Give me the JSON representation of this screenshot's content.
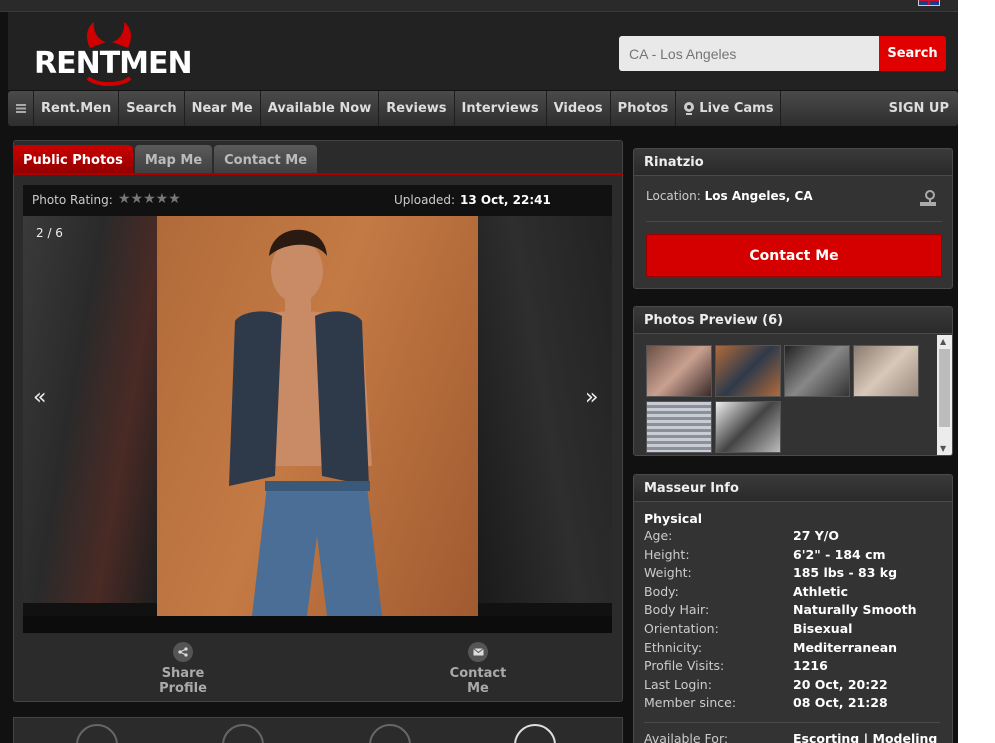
{
  "brand": {
    "logo_text": "RENTMEN"
  },
  "search": {
    "placeholder": "CA - Los Angeles",
    "button": "Search"
  },
  "nav": {
    "menu_icon": "menu-icon",
    "items": [
      "Rent.Men",
      "Search",
      "Near Me",
      "Available Now",
      "Reviews",
      "Interviews",
      "Videos",
      "Photos",
      "Live Cams"
    ],
    "signup": "SIGN UP"
  },
  "tabs": [
    "Public Photos",
    "Map Me",
    "Contact Me"
  ],
  "photo": {
    "rating_label": "Photo Rating:",
    "stars": "★★★★★",
    "uploaded_label": "Uploaded:",
    "uploaded_value": "13 Oct, 22:41",
    "counter": "2 / 6",
    "prev": "«",
    "next": "»"
  },
  "actions": {
    "share": "Share Profile",
    "contact": "Contact Me"
  },
  "profile": {
    "name": "Rinatzio",
    "location_label": "Location:",
    "location_value": "Los Angeles, CA",
    "contact_button": "Contact Me"
  },
  "preview": {
    "title": "Photos Preview (6)",
    "count": 6
  },
  "info": {
    "title": "Masseur Info",
    "section": "Physical",
    "rows": [
      {
        "k": "Age:",
        "v": "27 Y/O"
      },
      {
        "k": "Height:",
        "v": "6'2\" - 184 cm"
      },
      {
        "k": "Weight:",
        "v": "185 lbs - 83 kg"
      },
      {
        "k": "Body:",
        "v": "Athletic"
      },
      {
        "k": "Body Hair:",
        "v": "Naturally Smooth"
      },
      {
        "k": "Orientation:",
        "v": "Bisexual"
      },
      {
        "k": "Ethnicity:",
        "v": "Mediterranean"
      },
      {
        "k": "Profile Visits:",
        "v": "1216"
      },
      {
        "k": "Last Login:",
        "v": "20 Oct, 20:22"
      },
      {
        "k": "Member since:",
        "v": "08 Oct, 21:28"
      }
    ],
    "available": {
      "k": "Available For:",
      "v": "Escorting | Modeling"
    }
  },
  "colors": {
    "accent": "#e10000",
    "panel": "#333333",
    "background": "#111111"
  }
}
